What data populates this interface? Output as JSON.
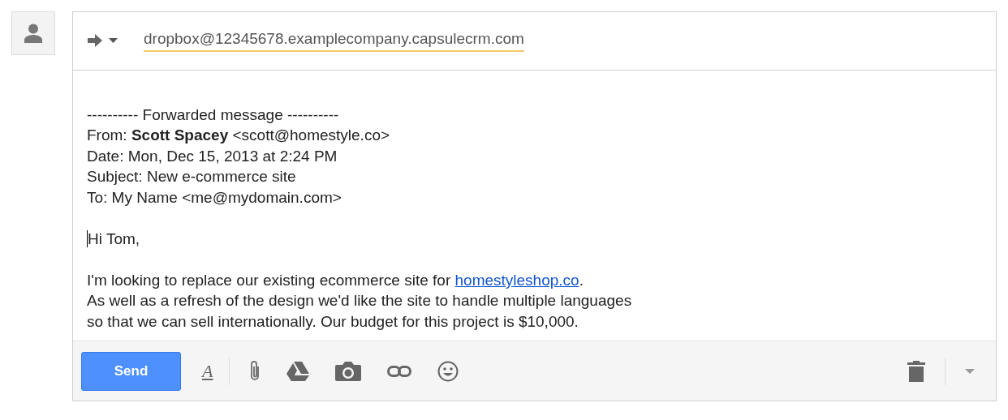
{
  "recipient": {
    "address": "dropbox@12345678.examplecompany.capsulecrm.com"
  },
  "forwarded": {
    "separator": "---------- Forwarded message ----------",
    "lines": [
      "From: **Scott Spacey** <scott@homestyle.co>",
      "Date: Mon, Dec 15, 2013 at 2:24 PM",
      "Subject: New e-commerce site",
      "To: My Name <me@mydomain.com>"
    ]
  },
  "greeting": "Hi Tom,",
  "paragraph": {
    "before": "I'm looking to replace our existing ecommerce site for ",
    "link": "homestyleshop.co",
    "after": ".",
    "lines": [
      "As well as a refresh of the design we'd like the site to handle multiple languages",
      "so that we can sell internationally. Our budget for this project is $10,000."
    ]
  },
  "toolbar": {
    "send": "Send",
    "format": "A"
  }
}
